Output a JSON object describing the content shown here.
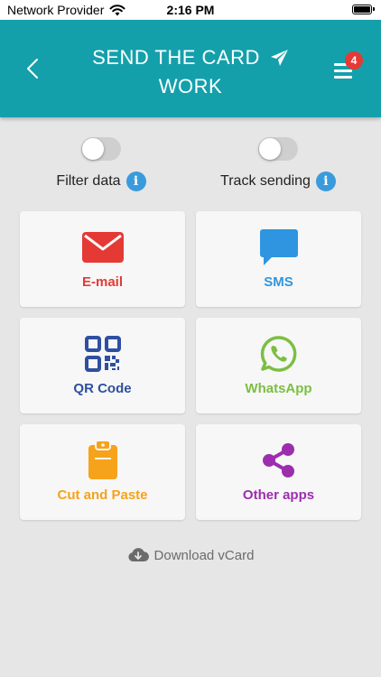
{
  "status": {
    "carrier": "Network Provider",
    "time": "2:16 PM"
  },
  "header": {
    "title_line1": "SEND THE CARD",
    "title_line2": "WORK",
    "badge_count": "4",
    "bg_color": "#14a0ab"
  },
  "toggles": [
    {
      "label": "Filter data",
      "on": false
    },
    {
      "label": "Track sending",
      "on": false
    }
  ],
  "options": [
    {
      "label": "E-mail",
      "color": "#e53935",
      "icon": "envelope-icon"
    },
    {
      "label": "SMS",
      "color": "#2f95e0",
      "icon": "chat-bubble-icon"
    },
    {
      "label": "QR Code",
      "color": "#2f4fa0",
      "icon": "qr-code-icon"
    },
    {
      "label": "WhatsApp",
      "color": "#7cbe43",
      "icon": "whatsapp-icon"
    },
    {
      "label": "Cut and Paste",
      "color": "#f7a21b",
      "icon": "clipboard-icon"
    },
    {
      "label": "Other apps",
      "color": "#9c2eae",
      "icon": "share-icon"
    }
  ],
  "download": {
    "label": "Download vCard",
    "icon": "cloud-download-icon"
  }
}
